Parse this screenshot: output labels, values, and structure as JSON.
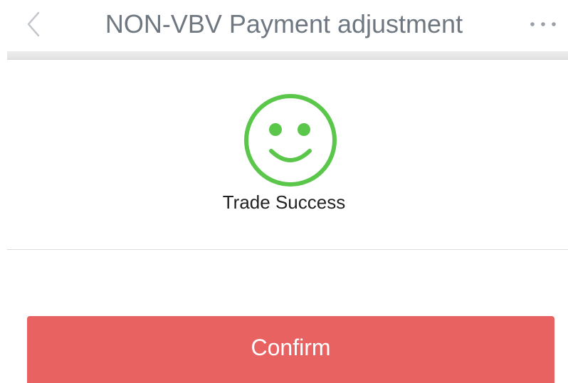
{
  "header": {
    "back_icon": "chevron-left-icon",
    "title": "NON-VBV Payment adjustment",
    "more_icon": "more-dots-icon"
  },
  "result": {
    "icon": "smile-icon",
    "icon_color": "#5ac74a",
    "message": "Trade Success"
  },
  "actions": {
    "confirm_label": "Confirm",
    "confirm_color": "#e86262"
  }
}
